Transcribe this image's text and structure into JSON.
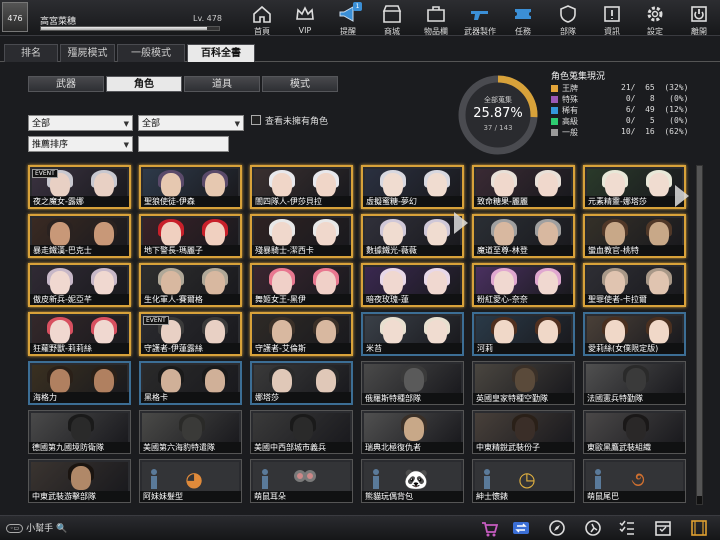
{
  "player": {
    "avatar_label": "476",
    "name": "高宮菜穗",
    "level": "Lv. 478",
    "xp_fraction": 0.93
  },
  "nav": [
    {
      "label": "首頁",
      "icon": "home-icon"
    },
    {
      "label": "VIP",
      "icon": "crown-icon"
    },
    {
      "label": "提醒",
      "icon": "megaphone-icon",
      "badge": "1"
    },
    {
      "label": "商城",
      "icon": "store-icon"
    },
    {
      "label": "物品欄",
      "icon": "briefcase-icon"
    },
    {
      "label": "武器製作",
      "icon": "gun-icon"
    },
    {
      "label": "任務",
      "icon": "ticket-icon"
    },
    {
      "label": "部隊",
      "icon": "shield-icon"
    },
    {
      "label": "資訊",
      "icon": "alert-icon"
    },
    {
      "label": "設定",
      "icon": "gear-icon"
    },
    {
      "label": "離開",
      "icon": "power-icon"
    }
  ],
  "tabs": [
    "排名",
    "殭屍模式",
    "一般模式",
    "百科全書"
  ],
  "active_tab": 3,
  "subtabs": [
    "武器",
    "角色",
    "道具",
    "模式"
  ],
  "active_subtab": 1,
  "filters": {
    "select1": "全部",
    "select2": "全部",
    "sort": "推薦排序",
    "search_value": "",
    "show_unowned_label": "查看未擁有角色"
  },
  "collection": {
    "title": "全部蒐集",
    "percent": "25.87%",
    "count": "37 / 143",
    "fraction": 0.2587
  },
  "stats_title": "角色蒐集現況",
  "stats": [
    {
      "name": "王牌",
      "count": "21/  65  (32%)",
      "color": "#e3a53a"
    },
    {
      "name": "特殊",
      "count": " 0/   8   (0%)",
      "color": "#9b59b6"
    },
    {
      "name": "稀有",
      "count": " 6/  49  (12%)",
      "color": "#3498db"
    },
    {
      "name": "高級",
      "count": " 0/   5   (0%)",
      "color": "#2ecc71"
    },
    {
      "name": "一般",
      "count": "10/  16  (62%)",
      "color": "#9a9a9a"
    }
  ],
  "cards": [
    {
      "name": "夜之魔女-露娜",
      "tier": "gold",
      "event": "EVENT",
      "bg": "#3a3240",
      "face": "#e8d0c4",
      "hair": "#c8c8d0"
    },
    {
      "name": "聖狼使徒-伊森",
      "tier": "gold",
      "bg": "#2e3a4a",
      "face": "#e6c8b0",
      "hair": "#5a4a6a"
    },
    {
      "name": "闇四隊人-伊莎貝拉",
      "tier": "gold",
      "bg": "#3a3030",
      "face": "#f0d6c8",
      "hair": "#e8e8ec"
    },
    {
      "name": "虛擬蜜糖-夢幻",
      "tier": "gold",
      "bg": "#2a3040",
      "face": "#f0dcd0",
      "hair": "#d8d8e0"
    },
    {
      "name": "致命糖果-麗麗",
      "tier": "gold",
      "bg": "#3a2a34",
      "face": "#f0d8cc",
      "hair": "#e8e0d8"
    },
    {
      "name": "元素精靈-娜塔莎",
      "tier": "gold",
      "bg": "#2a3a2a",
      "face": "#f0dcd0",
      "hair": "#e8e8d8"
    },
    {
      "name": "暴走鐵漢-巴克士",
      "tier": "gold",
      "bg": "#3a2a22",
      "face": "#c89878",
      "hair": "#2a2220"
    },
    {
      "name": "地下警長-瑪麗子",
      "tier": "gold",
      "bg": "#3a2228",
      "face": "#f0d0c0",
      "hair": "#c8202a"
    },
    {
      "name": "殘暴騎士-潔西卡",
      "tier": "gold",
      "bg": "#2e2222",
      "face": "#f0d8cc",
      "hair": "#e8e8e8"
    },
    {
      "name": "數據鐵光-薇薇",
      "tier": "gold",
      "bg": "#30303a",
      "face": "#f0dcd0",
      "hair": "#d0c8d8"
    },
    {
      "name": "魔道至尊-林登",
      "tier": "gold",
      "bg": "#2a2e34",
      "face": "#d8b8a0",
      "hair": "#a0a0a0"
    },
    {
      "name": "蠻血教官-桃特",
      "tier": "gold",
      "bg": "#343028",
      "face": "#c8a888",
      "hair": "#503828"
    },
    {
      "name": "傲皮新兵-妮亞芊",
      "tier": "gold",
      "bg": "#302a34",
      "face": "#f0d8d0",
      "hair": "#c8b8c8"
    },
    {
      "name": "生化軍人-賽爾格",
      "tier": "gold",
      "bg": "#2e2e2e",
      "face": "#d8b8a0",
      "hair": "#b0a898"
    },
    {
      "name": "舞姬女王-黑伊",
      "tier": "gold",
      "bg": "#3a2630",
      "face": "#f0d0c8",
      "hair": "#e87890"
    },
    {
      "name": "暗夜玫瑰-蓮",
      "tier": "gold",
      "bg": "#3a2850",
      "face": "#f0d8d0",
      "hair": "#e8d8e8"
    },
    {
      "name": "粉紅愛心-奈奈",
      "tier": "gold",
      "bg": "#4a3060",
      "face": "#f0d8d0",
      "hair": "#e0a8d0"
    },
    {
      "name": "聖罪使者-卡拉爾",
      "tier": "gold",
      "bg": "#2e2e34",
      "face": "#e0c4b0",
      "hair": "#a89888"
    },
    {
      "name": "狂蘿野獸-莉莉絲",
      "tier": "gold",
      "bg": "#34282a",
      "face": "#f0d8d0",
      "hair": "#d85060"
    },
    {
      "name": "守護者-伊蓮露絲",
      "tier": "gold",
      "event": "EVENT",
      "bg": "#2a2a2e",
      "face": "#e8d0c4",
      "hair": "#3a3a3a"
    },
    {
      "name": "守護者-艾倫斯",
      "tier": "gold",
      "bg": "#2e2a26",
      "face": "#d8b8a0",
      "hair": "#3a3028"
    },
    {
      "name": "米苔",
      "tier": "blue",
      "bg": "#3a4048",
      "face": "#f0dcd0",
      "hair": "#e8e0d0"
    },
    {
      "name": "河莉",
      "tier": "blue",
      "bg": "#2a3a48",
      "face": "#f0d8c8",
      "hair": "#503020"
    },
    {
      "name": "愛莉絲(女僕限定版)",
      "tier": "blue",
      "bg": "#4a4038",
      "face": "#f0d8c8",
      "hair": "#4a3020"
    },
    {
      "name": "海格力",
      "tier": "blue",
      "bg": "#3a3020",
      "face": "#b08060",
      "hair": "#2a2018"
    },
    {
      "name": "黑格卡",
      "tier": "blue",
      "bg": "#2a2a2a",
      "face": "#d0b098",
      "hair": "#1a1a1a"
    },
    {
      "name": "娜塔莎",
      "tier": "blue",
      "bg": "#3a3a3a",
      "face": "#e0c8b8",
      "hair": "#2a2a2a"
    },
    {
      "name": "俄羅斯特種部隊",
      "tier": "gray",
      "bg": "#4a4a4a",
      "face": "#5a5a5a",
      "hair": "#3a3a3a"
    },
    {
      "name": "英國皇家特種空勤隊",
      "tier": "gray",
      "bg": "#4a4640",
      "face": "#5a4a3a",
      "hair": "#3a3028"
    },
    {
      "name": "法國憲兵特勤隊",
      "tier": "gray",
      "bg": "#505050",
      "face": "#3a3a3a",
      "hair": "#2a2a2a"
    },
    {
      "name": "德國第九國境防衛隊",
      "tier": "gray",
      "bg": "#4a4a4a",
      "face": "#2a2a2a",
      "hair": "#1a1a1a"
    },
    {
      "name": "美國第六海豹特遣隊",
      "tier": "gray",
      "bg": "#4a4a48",
      "face": "#3a3a38",
      "hair": "#2a2a28"
    },
    {
      "name": "美國中西部城市義兵",
      "tier": "gray",
      "bg": "#3a3a3a",
      "face": "#2a2a2a",
      "hair": "#1a1a1a"
    },
    {
      "name": "瑞典北極復仇者",
      "tier": "gray",
      "bg": "#505050",
      "face": "#c8a888",
      "hair": "#3a3028"
    },
    {
      "name": "中東精銳武裝份子",
      "tier": "gray",
      "bg": "#48403a",
      "face": "#3a2e28",
      "hair": "#2a2018"
    },
    {
      "name": "東歐黑鷹武裝組織",
      "tier": "gray",
      "bg": "#4a4848",
      "face": "#2a2828",
      "hair": "#1a1818"
    },
    {
      "name": "中東武裝游擊部隊",
      "tier": "gray",
      "bg": "#3a3430",
      "face": "#b08868",
      "hair": "#1a1410"
    },
    {
      "name": "阿妹妹髮型",
      "tier": "gray",
      "item": true,
      "icon_name": "hair-item-icon",
      "glyph": "◕",
      "glyph_color": "#e08a3a"
    },
    {
      "name": "萌鼠耳朵",
      "tier": "gray",
      "item": true,
      "icon_name": "mouse-ears-icon",
      "glyph": "",
      "glyph_color": "#888"
    },
    {
      "name": "熊貓玩偶背包",
      "tier": "gray",
      "item": true,
      "icon_name": "panda-backpack-icon",
      "glyph": "🐼",
      "glyph_color": "#eee"
    },
    {
      "name": "紳士懷錶",
      "tier": "gray",
      "item": true,
      "icon_name": "pocket-watch-icon",
      "glyph": "◷",
      "glyph_color": "#e0b040"
    },
    {
      "name": "萌鼠尾巴",
      "tier": "gray",
      "item": true,
      "icon_name": "mouse-tail-icon",
      "glyph": "૭",
      "glyph_color": "#d07030"
    }
  ],
  "helper_label": "小幫手",
  "bottom_icons": [
    "cart-icon",
    "exchange-icon",
    "compass-icon",
    "runner-icon",
    "checklist-icon",
    "calendar-icon",
    "film-icon"
  ]
}
